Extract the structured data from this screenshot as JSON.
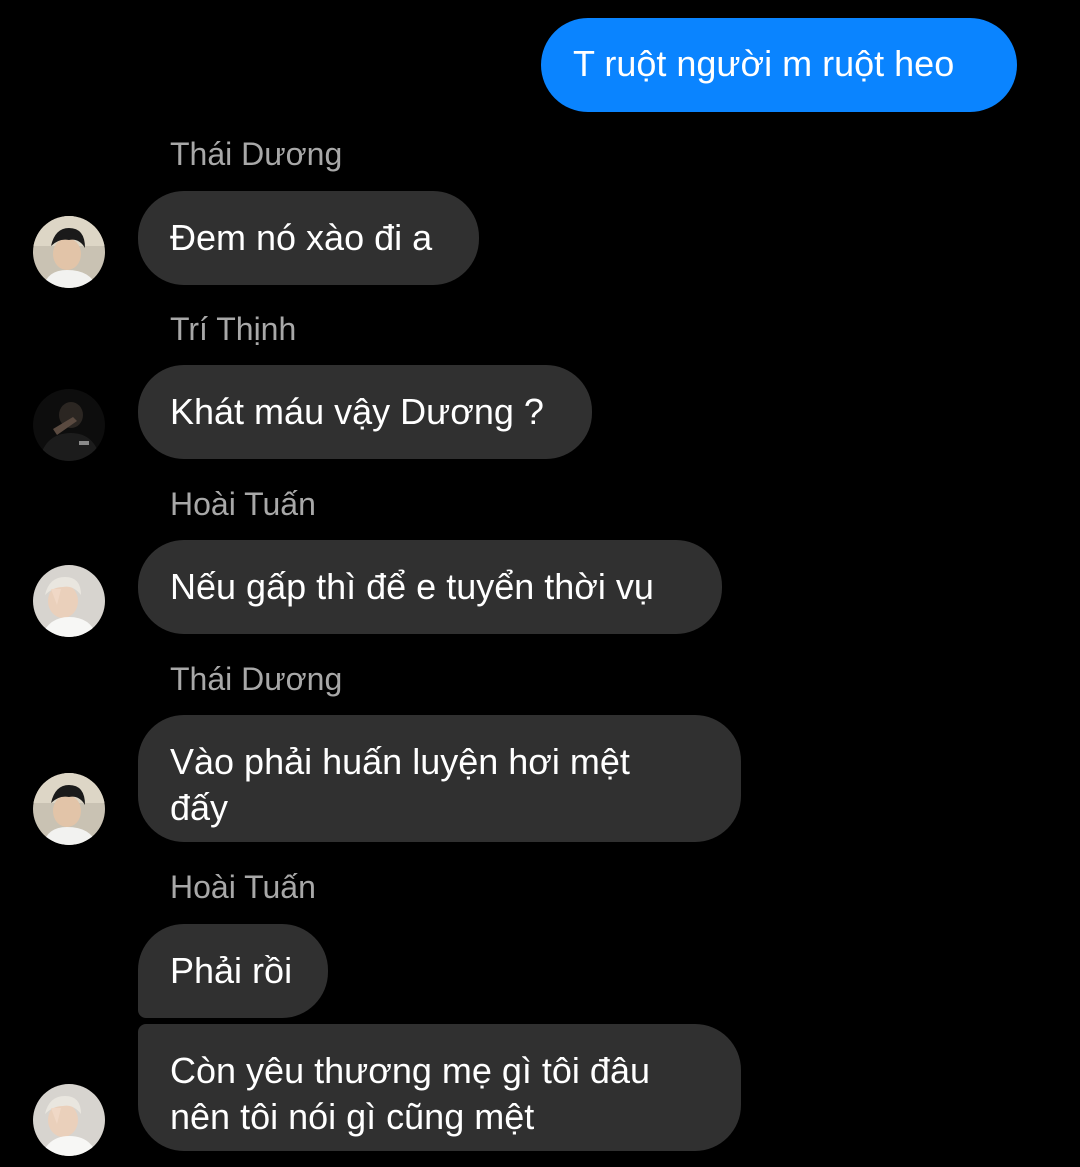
{
  "messages": [
    {
      "direction": "outgoing",
      "text": "T ruột người m ruột heo"
    },
    {
      "direction": "incoming",
      "sender": "Thái Dương",
      "text": "Đem nó xào đi a",
      "avatar": "avatar-thai-duong"
    },
    {
      "direction": "incoming",
      "sender": "Trí Thịnh",
      "text": "Khát máu vậy Dương ?",
      "avatar": "avatar-tri-thinh"
    },
    {
      "direction": "incoming",
      "sender": "Hoài Tuấn",
      "text": "Nếu gấp thì để e tuyển thời vụ",
      "avatar": "avatar-hoai-tuan"
    },
    {
      "direction": "incoming",
      "sender": "Thái Dương",
      "text": "Vào phải huấn luyện hơi mệt đấy",
      "avatar": "avatar-thai-duong"
    },
    {
      "direction": "incoming",
      "sender": "Hoài Tuấn",
      "text": "Phải rồi"
    },
    {
      "direction": "incoming",
      "text": "Còn yêu thương mẹ gì tôi đâu nên tôi nói gì cũng mệt",
      "avatar": "avatar-hoai-tuan"
    }
  ],
  "colors": {
    "background": "#000000",
    "outgoing_bubble": "#0a84ff",
    "incoming_bubble": "#303030",
    "sender_name": "#a8a8a8"
  }
}
